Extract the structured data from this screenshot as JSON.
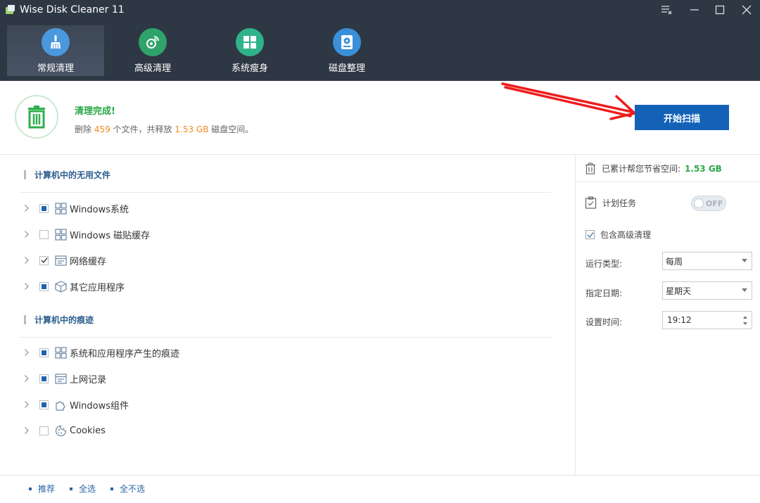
{
  "window": {
    "title": "Wise Disk Cleaner 11"
  },
  "nav": {
    "items": [
      {
        "label": "常规清理",
        "icon": "broom-icon",
        "color": "#4a98dd"
      },
      {
        "label": "高级清理",
        "icon": "satellite-icon",
        "color": "#2fa36a"
      },
      {
        "label": "系统瘦身",
        "icon": "windows-icon",
        "color": "#2fb38a"
      },
      {
        "label": "磁盘整理",
        "icon": "disk-icon",
        "color": "#3a8fd8"
      }
    ]
  },
  "status": {
    "title": "清理完成!",
    "line_prefix": "删除 ",
    "files_count": "459",
    "line_mid": " 个文件，共释放 ",
    "freed": "1.53 GB",
    "line_suffix": " 磁盘空间。",
    "scan_button": "开始扫描"
  },
  "sections": [
    {
      "title": "计算机中的无用文件",
      "items": [
        {
          "label": "Windows系统",
          "state": "partial",
          "icon": "windows-grid-icon"
        },
        {
          "label": "Windows 磁贴缓存",
          "state": "unchecked",
          "icon": "windows-grid-icon"
        },
        {
          "label": "网络缓存",
          "state": "checked",
          "icon": "browser-icon"
        },
        {
          "label": "其它应用程序",
          "state": "partial",
          "icon": "box-icon"
        }
      ]
    },
    {
      "title": "计算机中的痕迹",
      "items": [
        {
          "label": "系统和应用程序产生的痕迹",
          "state": "partial",
          "icon": "windows-grid-icon"
        },
        {
          "label": "上网记录",
          "state": "partial",
          "icon": "browser-icon"
        },
        {
          "label": "Windows组件",
          "state": "partial",
          "icon": "puzzle-icon"
        },
        {
          "label": "Cookies",
          "state": "unchecked",
          "icon": "cookie-icon"
        }
      ]
    }
  ],
  "right_panel": {
    "saved_label": "已累计帮您节省空间:",
    "saved_value": "1.53 GB",
    "schedule_label": "计划任务",
    "toggle_text": "OFF",
    "include_advanced": "包含高级清理",
    "run_type_label": "运行类型:",
    "run_type_value": "每周",
    "date_label": "指定日期:",
    "date_value": "星期天",
    "time_label": "设置时间:",
    "time_value": "19:12"
  },
  "footer": {
    "recommend": "推荐",
    "select_all": "全选",
    "select_none": "全不选"
  }
}
